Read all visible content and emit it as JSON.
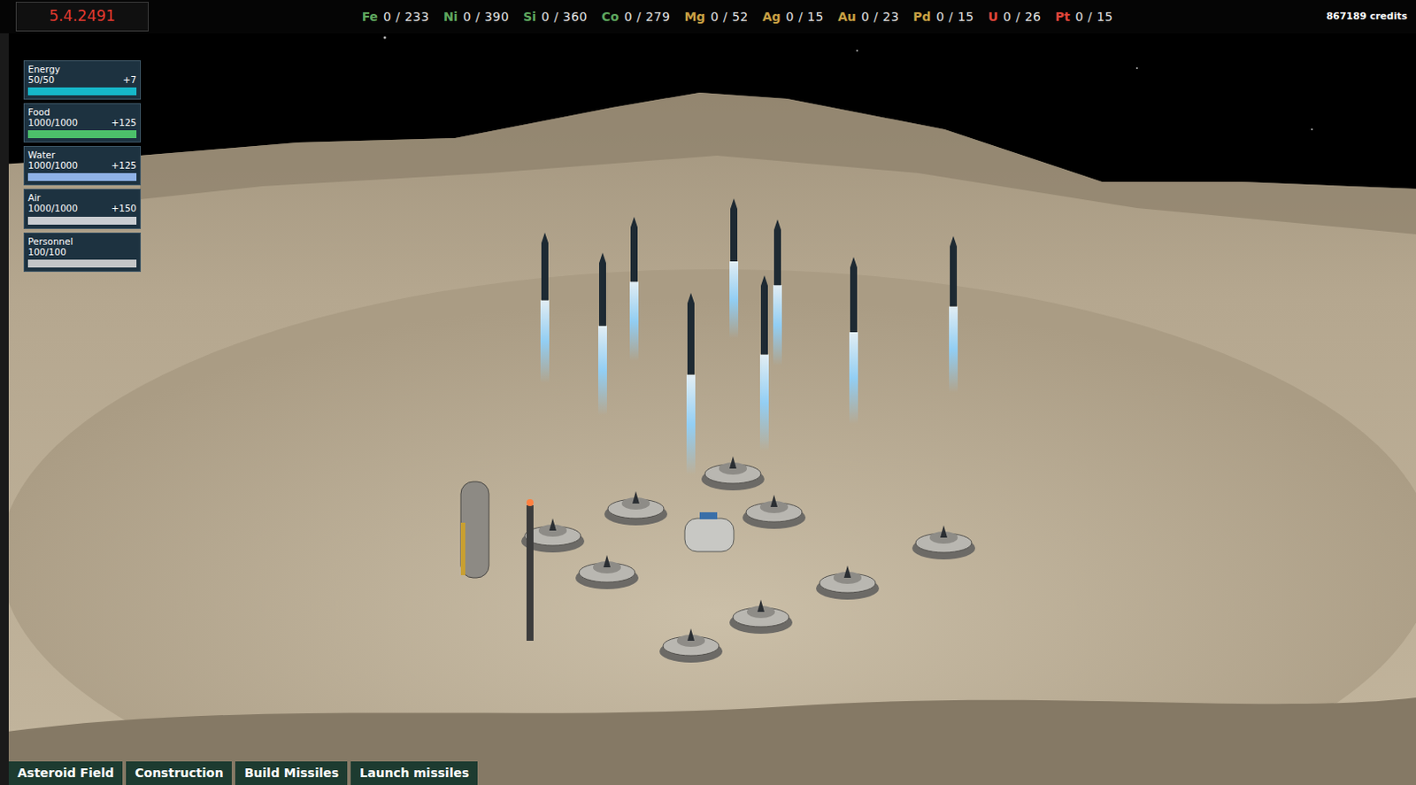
{
  "date": "5.4.2491",
  "resources": [
    {
      "symbol": "Fe",
      "reading": "0 / 233",
      "color": "#5fa85f"
    },
    {
      "symbol": "Ni",
      "reading": "0 / 390",
      "color": "#5fa85f"
    },
    {
      "symbol": "Si",
      "reading": "0 / 360",
      "color": "#5fa85f"
    },
    {
      "symbol": "Co",
      "reading": "0 / 279",
      "color": "#5fa85f"
    },
    {
      "symbol": "Mg",
      "reading": "0 / 52",
      "color": "#c9a043"
    },
    {
      "symbol": "Ag",
      "reading": "0 / 15",
      "color": "#c9a043"
    },
    {
      "symbol": "Au",
      "reading": "0 / 23",
      "color": "#c9a043"
    },
    {
      "symbol": "Pd",
      "reading": "0 / 15",
      "color": "#c9a043"
    },
    {
      "symbol": "U",
      "reading": "0 / 26",
      "color": "#e0453a"
    },
    {
      "symbol": "Pt",
      "reading": "0 / 15",
      "color": "#e0453a"
    }
  ],
  "credits": "867189 credits",
  "stats": [
    {
      "label": "Energy",
      "value": "50/50",
      "rate": "+7",
      "level": 1,
      "color": "#16b7c9"
    },
    {
      "label": "Food",
      "value": "1000/1000",
      "rate": "+125",
      "level": 1,
      "color": "#4cc06a"
    },
    {
      "label": "Water",
      "value": "1000/1000",
      "rate": "+125",
      "level": 1,
      "color": "#8fb2e6"
    },
    {
      "label": "Air",
      "value": "1000/1000",
      "rate": "+150",
      "level": 1,
      "color": "#c9cdd1"
    },
    {
      "label": "Personnel",
      "value": "100/100",
      "level": 1,
      "color": "#c4c6c8"
    }
  ],
  "buttons": [
    "Asteroid Field",
    "Construction",
    "Build Missiles",
    "Launch missiles"
  ]
}
